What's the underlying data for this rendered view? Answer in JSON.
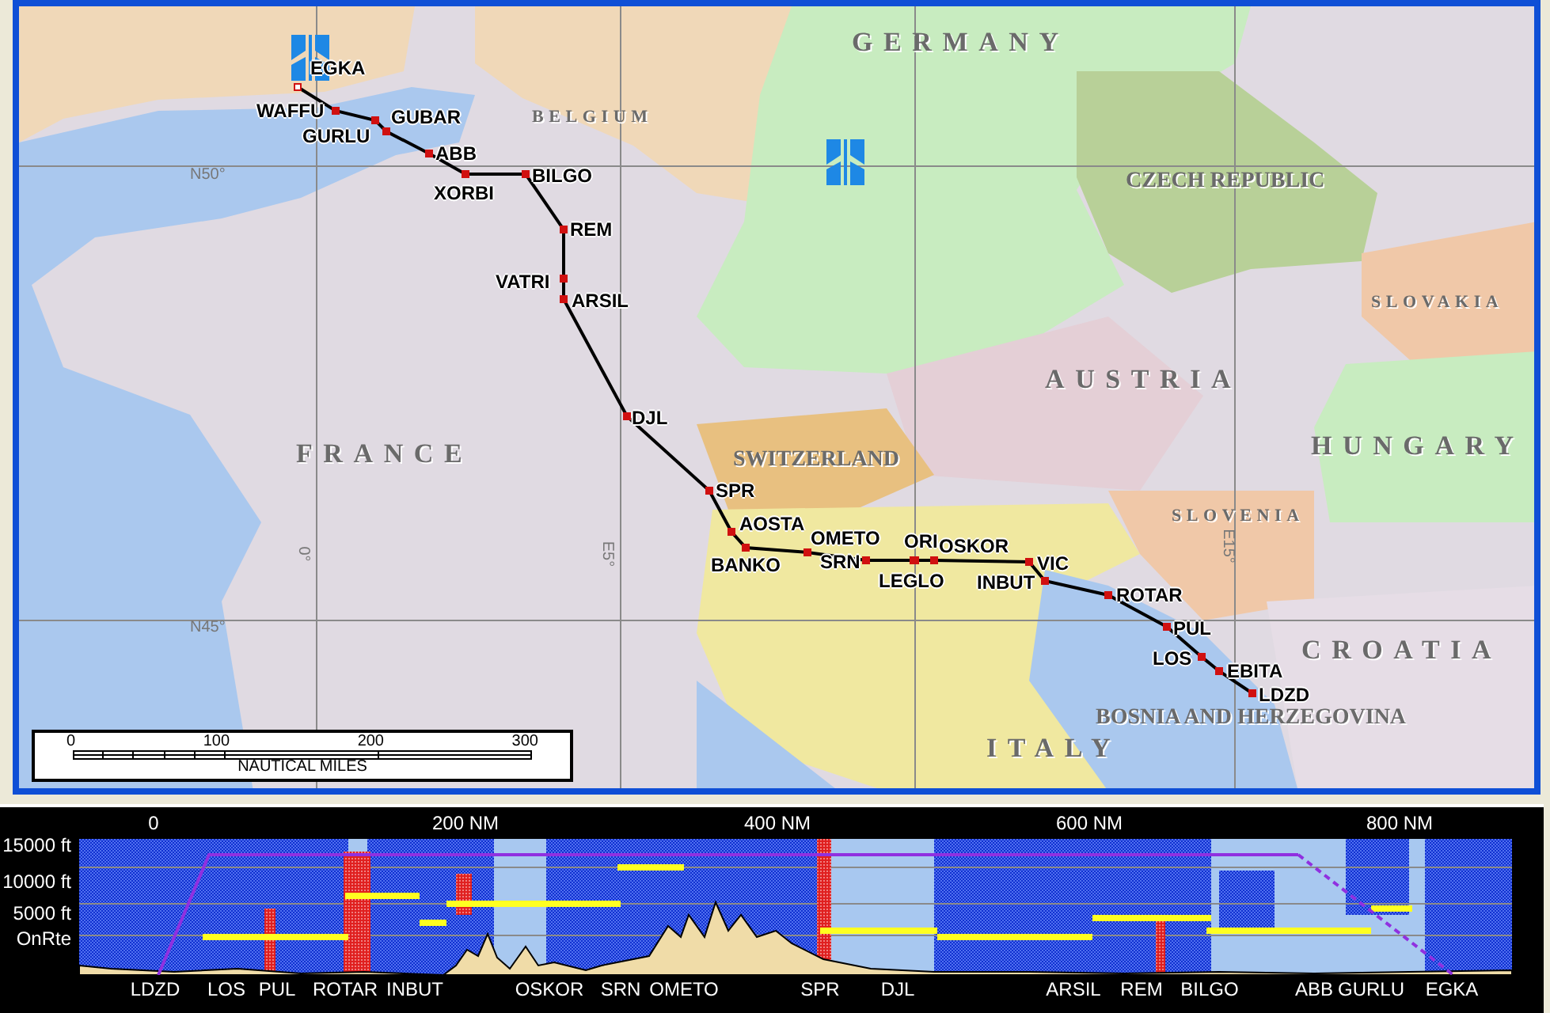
{
  "map": {
    "countries": [
      {
        "label": "GERMANY",
        "kind": "large"
      },
      {
        "label": "BELGIUM",
        "kind": "small"
      },
      {
        "label": "CZECH REPUBLIC",
        "kind": "medium"
      },
      {
        "label": "SLOVAKIA",
        "kind": "small"
      },
      {
        "label": "AUSTRIA",
        "kind": "large"
      },
      {
        "label": "SWITZERLAND",
        "kind": "medium"
      },
      {
        "label": "HUNGARY",
        "kind": "large"
      },
      {
        "label": "FRANCE",
        "kind": "large"
      },
      {
        "label": "SLOVENIA",
        "kind": "small"
      },
      {
        "label": "CROATIA",
        "kind": "large"
      },
      {
        "label": "BOSNIA AND HERZEGOVINA",
        "kind": "medium"
      },
      {
        "label": "ITALY",
        "kind": "large"
      }
    ],
    "grid_labels": [
      {
        "label": "N50°",
        "kind": "latitude"
      },
      {
        "label": "N45°",
        "kind": "latitude"
      },
      {
        "label": "0°",
        "kind": "longitude"
      },
      {
        "label": "E5°",
        "kind": "longitude"
      },
      {
        "label": "E15°",
        "kind": "longitude"
      }
    ],
    "waypoints": [
      {
        "label": "EGKA",
        "kind": "airport"
      },
      {
        "label": "WAFFU",
        "kind": "fix"
      },
      {
        "label": "GUBAR",
        "kind": "fix"
      },
      {
        "label": "GURLU",
        "kind": "fix"
      },
      {
        "label": "ABB",
        "kind": "fix"
      },
      {
        "label": "XORBI",
        "kind": "fix"
      },
      {
        "label": "BILGO",
        "kind": "fix"
      },
      {
        "label": "REM",
        "kind": "fix"
      },
      {
        "label": "VATRI",
        "kind": "fix"
      },
      {
        "label": "ARSIL",
        "kind": "fix"
      },
      {
        "label": "DJL",
        "kind": "fix"
      },
      {
        "label": "SPR",
        "kind": "fix"
      },
      {
        "label": "AOSTA",
        "kind": "fix"
      },
      {
        "label": "BANKO",
        "kind": "fix"
      },
      {
        "label": "OMETO",
        "kind": "fix"
      },
      {
        "label": "SRN",
        "kind": "fix"
      },
      {
        "label": "ORI",
        "kind": "fix"
      },
      {
        "label": "LEGLO",
        "kind": "fix"
      },
      {
        "label": "OSKOR",
        "kind": "fix"
      },
      {
        "label": "VIC",
        "kind": "fix"
      },
      {
        "label": "INBUT",
        "kind": "fix"
      },
      {
        "label": "ROTAR",
        "kind": "fix"
      },
      {
        "label": "PUL",
        "kind": "fix"
      },
      {
        "label": "LOS",
        "kind": "fix"
      },
      {
        "label": "EBITA",
        "kind": "fix"
      },
      {
        "label": "LDZD",
        "kind": "fix"
      }
    ],
    "scale_bar": {
      "ticks": [
        "0",
        "100",
        "200",
        "300"
      ],
      "unit": "NAUTICAL MILES"
    }
  },
  "profile": {
    "distance_ticks": [
      "0",
      "200 NM",
      "400 NM",
      "600 NM",
      "800 NM"
    ],
    "altitude_labels": [
      "15000 ft",
      "10000 ft",
      "5000 ft",
      "OnRte"
    ],
    "waypoints": [
      "LDZD",
      "LOS",
      "PUL",
      "ROTAR",
      "INBUT",
      "OSKOR",
      "SRN",
      "OMETO",
      "SPR",
      "DJL",
      "ARSIL",
      "REM",
      "BILGO",
      "ABB",
      "GURLU",
      "EGKA"
    ]
  }
}
